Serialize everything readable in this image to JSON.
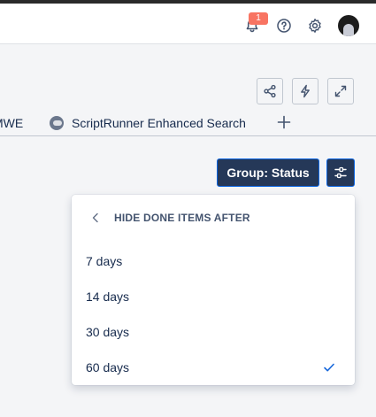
{
  "topbar": {
    "notification_count": "1",
    "icons": [
      "bell-icon",
      "help-icon",
      "gear-icon",
      "avatar"
    ]
  },
  "toolbar": {
    "icons": [
      "share-icon",
      "bolt-icon",
      "expand-icon"
    ]
  },
  "tabs": {
    "items": [
      {
        "label": "MWE"
      },
      {
        "label": "ScriptRunner Enhanced Search",
        "icon": "scriptrunner-icon"
      }
    ],
    "add_icon": "plus-icon"
  },
  "controls": {
    "group_label": "Group: Status",
    "filter_icon": "sliders-icon"
  },
  "dropdown": {
    "title": "HIDE DONE ITEMS AFTER",
    "options": [
      {
        "label": "7 days",
        "selected": false
      },
      {
        "label": "14 days",
        "selected": false
      },
      {
        "label": "30 days",
        "selected": false
      },
      {
        "label": "60 days",
        "selected": true
      }
    ]
  },
  "colors": {
    "accent": "#0c66e4",
    "button_dark": "#253858",
    "badge": "#f87462",
    "check": "#1868db"
  }
}
